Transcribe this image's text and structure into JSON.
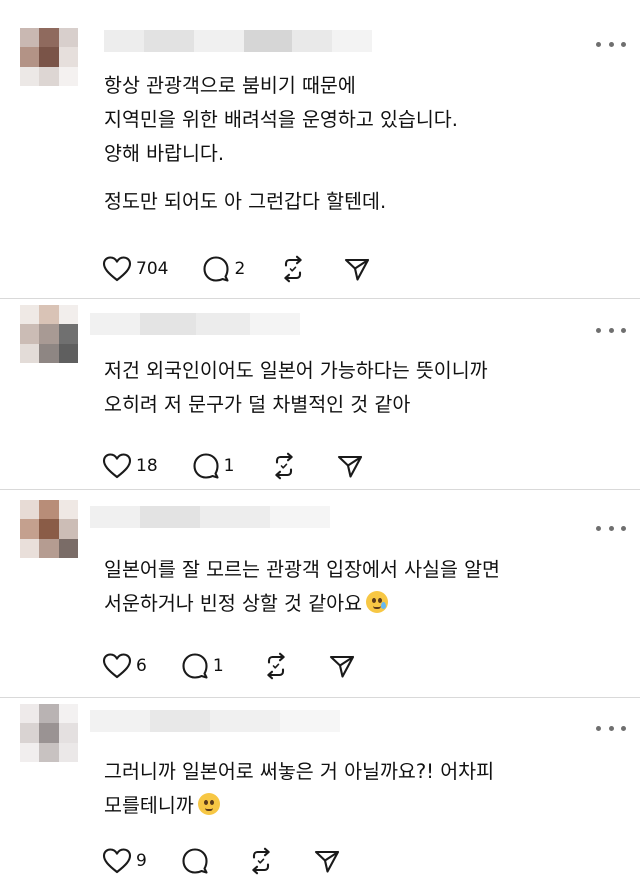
{
  "posts": [
    {
      "lines": [
        "항상 관광객으로 붐비기 때문에",
        "지역민을 위한 배려석을 운영하고 있습니다.",
        "양해 바랍니다.",
        "",
        "정도만 되어도 아 그런갑다 할텐데."
      ],
      "likes": "704",
      "replies": "2"
    },
    {
      "lines": [
        "저건 외국인이어도 일본어 가능하다는 뜻이니까",
        "오히려 저 문구가 덜 차별적인 것 같아"
      ],
      "likes": "18",
      "replies": "1"
    },
    {
      "lines": [
        "일본어를 잘 모르는 관광객 입장에서 사실을 알면",
        "서운하거나 빈정 상할 것 같아요"
      ],
      "emoji": "crying-face",
      "likes": "6",
      "replies": "1"
    },
    {
      "lines": [
        "그러니까 일본어로 써놓은 거 아닐까요?! 어차피",
        "모를테니까"
      ],
      "emoji": "pleading-face",
      "likes": "9",
      "replies": ""
    }
  ],
  "icons": {
    "like": "heart-icon",
    "reply": "speech-bubble-icon",
    "repost": "repost-icon",
    "share": "send-icon",
    "more": "more-icon"
  },
  "colors": {
    "text": "#111111",
    "icon": "#1a1a1a",
    "divider": "#d9d9d9",
    "more_dots": "#6f6f6f"
  }
}
